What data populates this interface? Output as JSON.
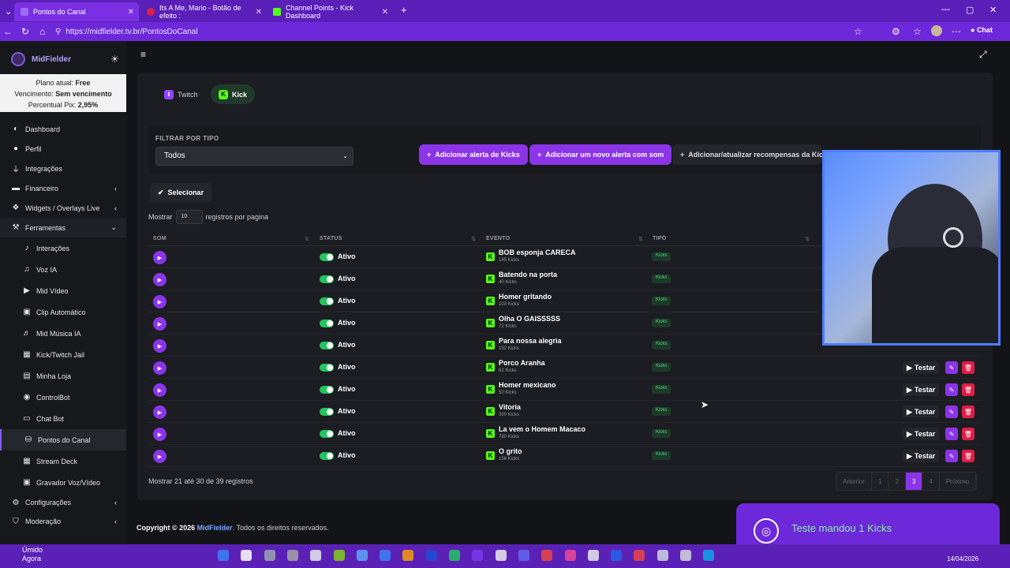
{
  "browser": {
    "tabs": [
      {
        "label": "Pontos do Canal",
        "active": true
      },
      {
        "label": "Its A Me, Mario - Botão de efeito :",
        "active": false
      },
      {
        "label": "Channel Points - Kick Dashboard",
        "active": false
      }
    ],
    "new_tab": "+",
    "url": "https://midfielder.tv.br/PontosDoCanal",
    "profile_chat": "Chat"
  },
  "sidebar": {
    "brand": "MidFielder",
    "plan": {
      "line1_label": "Plano atual:",
      "line1_value": "Free",
      "line2_label": "Vencimento:",
      "line2_value": "Sem vencimento",
      "line3_label": "Percentual Pix:",
      "line3_value": "2,95%"
    },
    "items": [
      {
        "label": "Dashboard",
        "icon": "dashboard-icon"
      },
      {
        "label": "Perfil",
        "icon": "user-icon"
      },
      {
        "label": "Integrações",
        "icon": "plug-icon"
      },
      {
        "label": "Financeiro",
        "icon": "money-icon"
      },
      {
        "label": "Widgets / Overlays Live",
        "icon": "widgets-icon"
      },
      {
        "label": "Ferramentas",
        "icon": "tools-icon"
      }
    ],
    "subitems": [
      {
        "label": "Interações"
      },
      {
        "label": "Voz IA"
      },
      {
        "label": "Mid Vídeo"
      },
      {
        "label": "Clip Automático"
      },
      {
        "label": "Mid Música IA"
      },
      {
        "label": "Kick/Twitch Jail"
      },
      {
        "label": "Minha Loja"
      },
      {
        "label": "ControlBot"
      },
      {
        "label": "Chat Bot"
      },
      {
        "label": "Pontos do Canal"
      },
      {
        "label": "Stream Deck"
      },
      {
        "label": "Gravador Voz/Vídeo"
      }
    ],
    "bottom_items": [
      {
        "label": "Configurações"
      },
      {
        "label": "Moderação"
      }
    ]
  },
  "platform_tabs": {
    "twitch": "Twitch",
    "kick": "Kick"
  },
  "filter": {
    "label": "FILTRAR POR TIPO",
    "selected": "Todos"
  },
  "actions": {
    "add_kicks": "Adicionar alerta de Kicks",
    "add_sound": "Adicionar um novo alerta com som",
    "update_rewards": "Adicionar/atualizar recompensas da Kick"
  },
  "select_button": "Selecionar",
  "page_size": {
    "prefix": "Mostrar",
    "value": "10",
    "suffix": "registros por pagina"
  },
  "table": {
    "headers": [
      "SOM",
      "STATUS",
      "EVENTO",
      "TIPO"
    ],
    "rows": [
      {
        "status": "Ativo",
        "name": "BOB esponja CARECA",
        "cost": "145 Kicks",
        "type": "Kicks"
      },
      {
        "status": "Ativo",
        "name": "Batendo na porta",
        "cost": "40 Kicks",
        "type": "Kicks"
      },
      {
        "status": "Ativo",
        "name": "Homer gritando",
        "cost": "103 Kicks",
        "type": "Kicks"
      },
      {
        "status": "Ativo",
        "name": "Olha O GAISSSSS",
        "cost": "72 Kicks",
        "type": "Kicks"
      },
      {
        "status": "Ativo",
        "name": "Para nossa alegria",
        "cost": "152 Kicks",
        "type": "Kicks"
      },
      {
        "status": "Ativo",
        "name": "Porco Aranha",
        "cost": "62 Kicks",
        "type": "Kicks"
      },
      {
        "status": "Ativo",
        "name": "Homer mexicano",
        "cost": "50 Kicks",
        "type": "Kicks"
      },
      {
        "status": "Ativo",
        "name": "Vitoria",
        "cost": "300 Kicks",
        "type": "Kicks"
      },
      {
        "status": "Ativo",
        "name": "La vem o Homem Macaco",
        "cost": "780 Kicks",
        "type": "Kicks"
      },
      {
        "status": "Ativo",
        "name": "O grito",
        "cost": "156 Kicks",
        "type": "Kicks"
      }
    ],
    "test_label": "Testar"
  },
  "footer_summary": "Mostrar 21 até 30 de 39 registros",
  "pagination": {
    "prev": "Anterior",
    "pages": [
      "1",
      "2",
      "3",
      "4"
    ],
    "current": "3",
    "next": "Próximo"
  },
  "copyright": {
    "prefix": "Copyright © 2026",
    "brand": "MidFielder",
    "suffix": ". Todos os direitos reservados."
  },
  "toast": {
    "text": "Teste mandou 1 Kicks"
  },
  "taskbar": {
    "weather_temp": "Úmido",
    "weather_sub": "Agora",
    "date": "14/04/2026"
  },
  "colors": {
    "accent": "#8b34e8",
    "kick_green": "#53fc18",
    "browser": "#6d28d9"
  }
}
